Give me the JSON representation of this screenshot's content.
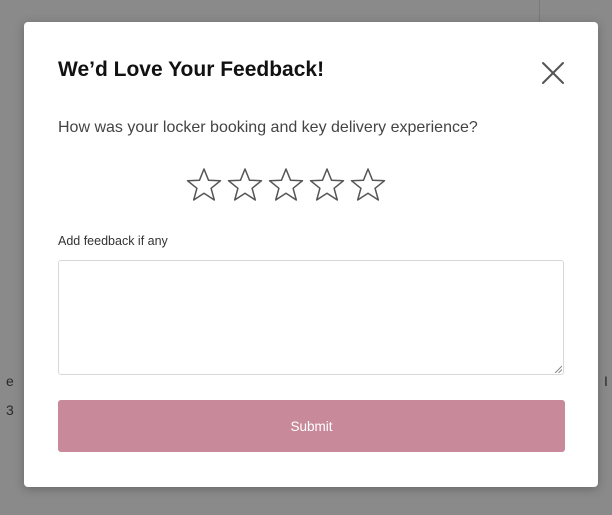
{
  "background": {
    "fragments": [
      "e",
      "3",
      "I"
    ]
  },
  "modal": {
    "title": "We’d Love Your Feedback!",
    "question": "How was your locker booking and key delivery experience?",
    "rating": {
      "max": 5,
      "value": 0
    },
    "feedback_label": "Add feedback if any",
    "feedback_value": "",
    "submit_label": "Submit"
  },
  "colors": {
    "submit_bg": "#c88a9a",
    "overlay": "#8a8a8a",
    "star_stroke": "#555555"
  },
  "icons": {
    "close": "close-icon",
    "star": "star-outline-icon"
  }
}
